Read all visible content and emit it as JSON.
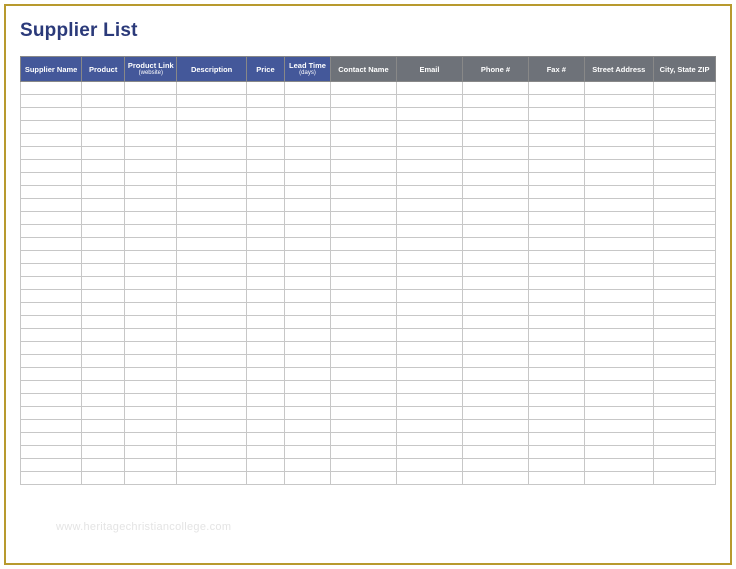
{
  "title": "Supplier List",
  "columns": [
    {
      "label": "Supplier Name",
      "sub": "",
      "class": "blue",
      "w": "col0"
    },
    {
      "label": "Product",
      "sub": "",
      "class": "blue",
      "w": "col1"
    },
    {
      "label": "Product Link",
      "sub": "(website)",
      "class": "blue",
      "w": "col2"
    },
    {
      "label": "Description",
      "sub": "",
      "class": "blue",
      "w": "col3"
    },
    {
      "label": "Price",
      "sub": "",
      "class": "blue",
      "w": "col4"
    },
    {
      "label": "Lead Time",
      "sub": "(days)",
      "class": "blue",
      "w": "col5"
    },
    {
      "label": "Contact Name",
      "sub": "",
      "class": "gray",
      "w": "col6"
    },
    {
      "label": "Email",
      "sub": "",
      "class": "gray",
      "w": "col7"
    },
    {
      "label": "Phone #",
      "sub": "",
      "class": "gray",
      "w": "col8"
    },
    {
      "label": "Fax #",
      "sub": "",
      "class": "gray",
      "w": "col9"
    },
    {
      "label": "Street Address",
      "sub": "",
      "class": "gray",
      "w": "col10"
    },
    {
      "label": "City, State ZIP",
      "sub": "",
      "class": "gray",
      "w": "col11"
    }
  ],
  "row_count": 31,
  "watermark": "www.heritagechristiancollege.com"
}
